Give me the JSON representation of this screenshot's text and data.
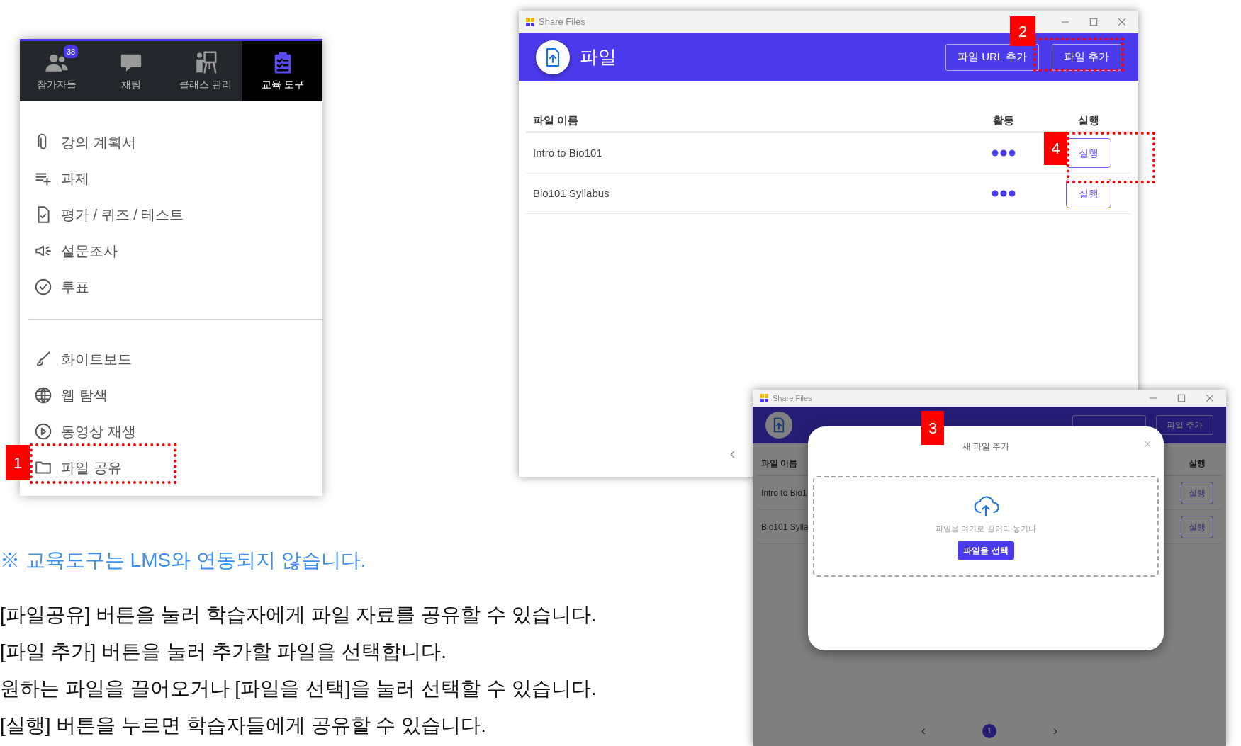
{
  "tools_panel": {
    "tabs": [
      {
        "label": "참가자들",
        "badge": "38",
        "selected": false
      },
      {
        "label": "채팅",
        "selected": false
      },
      {
        "label": "클래스 관리",
        "selected": false
      },
      {
        "label": "교육 도구",
        "selected": true
      }
    ],
    "menu_groups": [
      [
        "강의 계획서",
        "과제",
        "평가 / 퀴즈 / 테스트",
        "설문조사",
        "투표"
      ],
      [
        "화이트보드",
        "웹 탐색",
        "동영상 재생",
        "파일 공유"
      ]
    ]
  },
  "callouts": [
    "1",
    "2",
    "3",
    "4"
  ],
  "share_window": {
    "title": "Share Files",
    "header_title": "파일",
    "header_buttons": [
      "파일 URL 추가",
      "파일 추가"
    ],
    "columns": [
      "파일 이름",
      "활동",
      "실행"
    ],
    "rows": [
      {
        "name": "Intro to Bio101",
        "button": "실행"
      },
      {
        "name": "Bio101 Syllabus",
        "button": "실행"
      }
    ],
    "scroll_arrow": "‹"
  },
  "dialog_window": {
    "title": "Share Files",
    "header_button": "파일 추가",
    "columns": [
      "파일 이름",
      "실행"
    ],
    "rows": [
      {
        "name": "Intro to Bio1",
        "button": "실행"
      },
      {
        "name": "Bio101 Sylla",
        "button": "실행"
      }
    ],
    "pagination": {
      "prev": "‹",
      "pages": [
        {
          "label": "1",
          "selected": true
        }
      ],
      "next": "›"
    },
    "modal": {
      "title": "새 파일 추가",
      "close": "×",
      "hint": "파일을 여기로 끌어다 놓거나",
      "button": "파일을 선택"
    }
  },
  "notice": "※ 교육도구는 LMS와 연동되지 않습니다.",
  "instructions": [
    "[파일공유] 버튼을 눌러 학습자에게 파일 자료를 공유할 수 있습니다.",
    "[파일 추가] 버튼을 눌러 추가할 파일을 선택합니다.",
    "원하는 파일을 끌어오거나 [파일을 선택]을 눌러 선택할 수 있습니다.",
    "[실행] 버튼을 누르면 학습자들에게 공유할 수 있습니다."
  ]
}
